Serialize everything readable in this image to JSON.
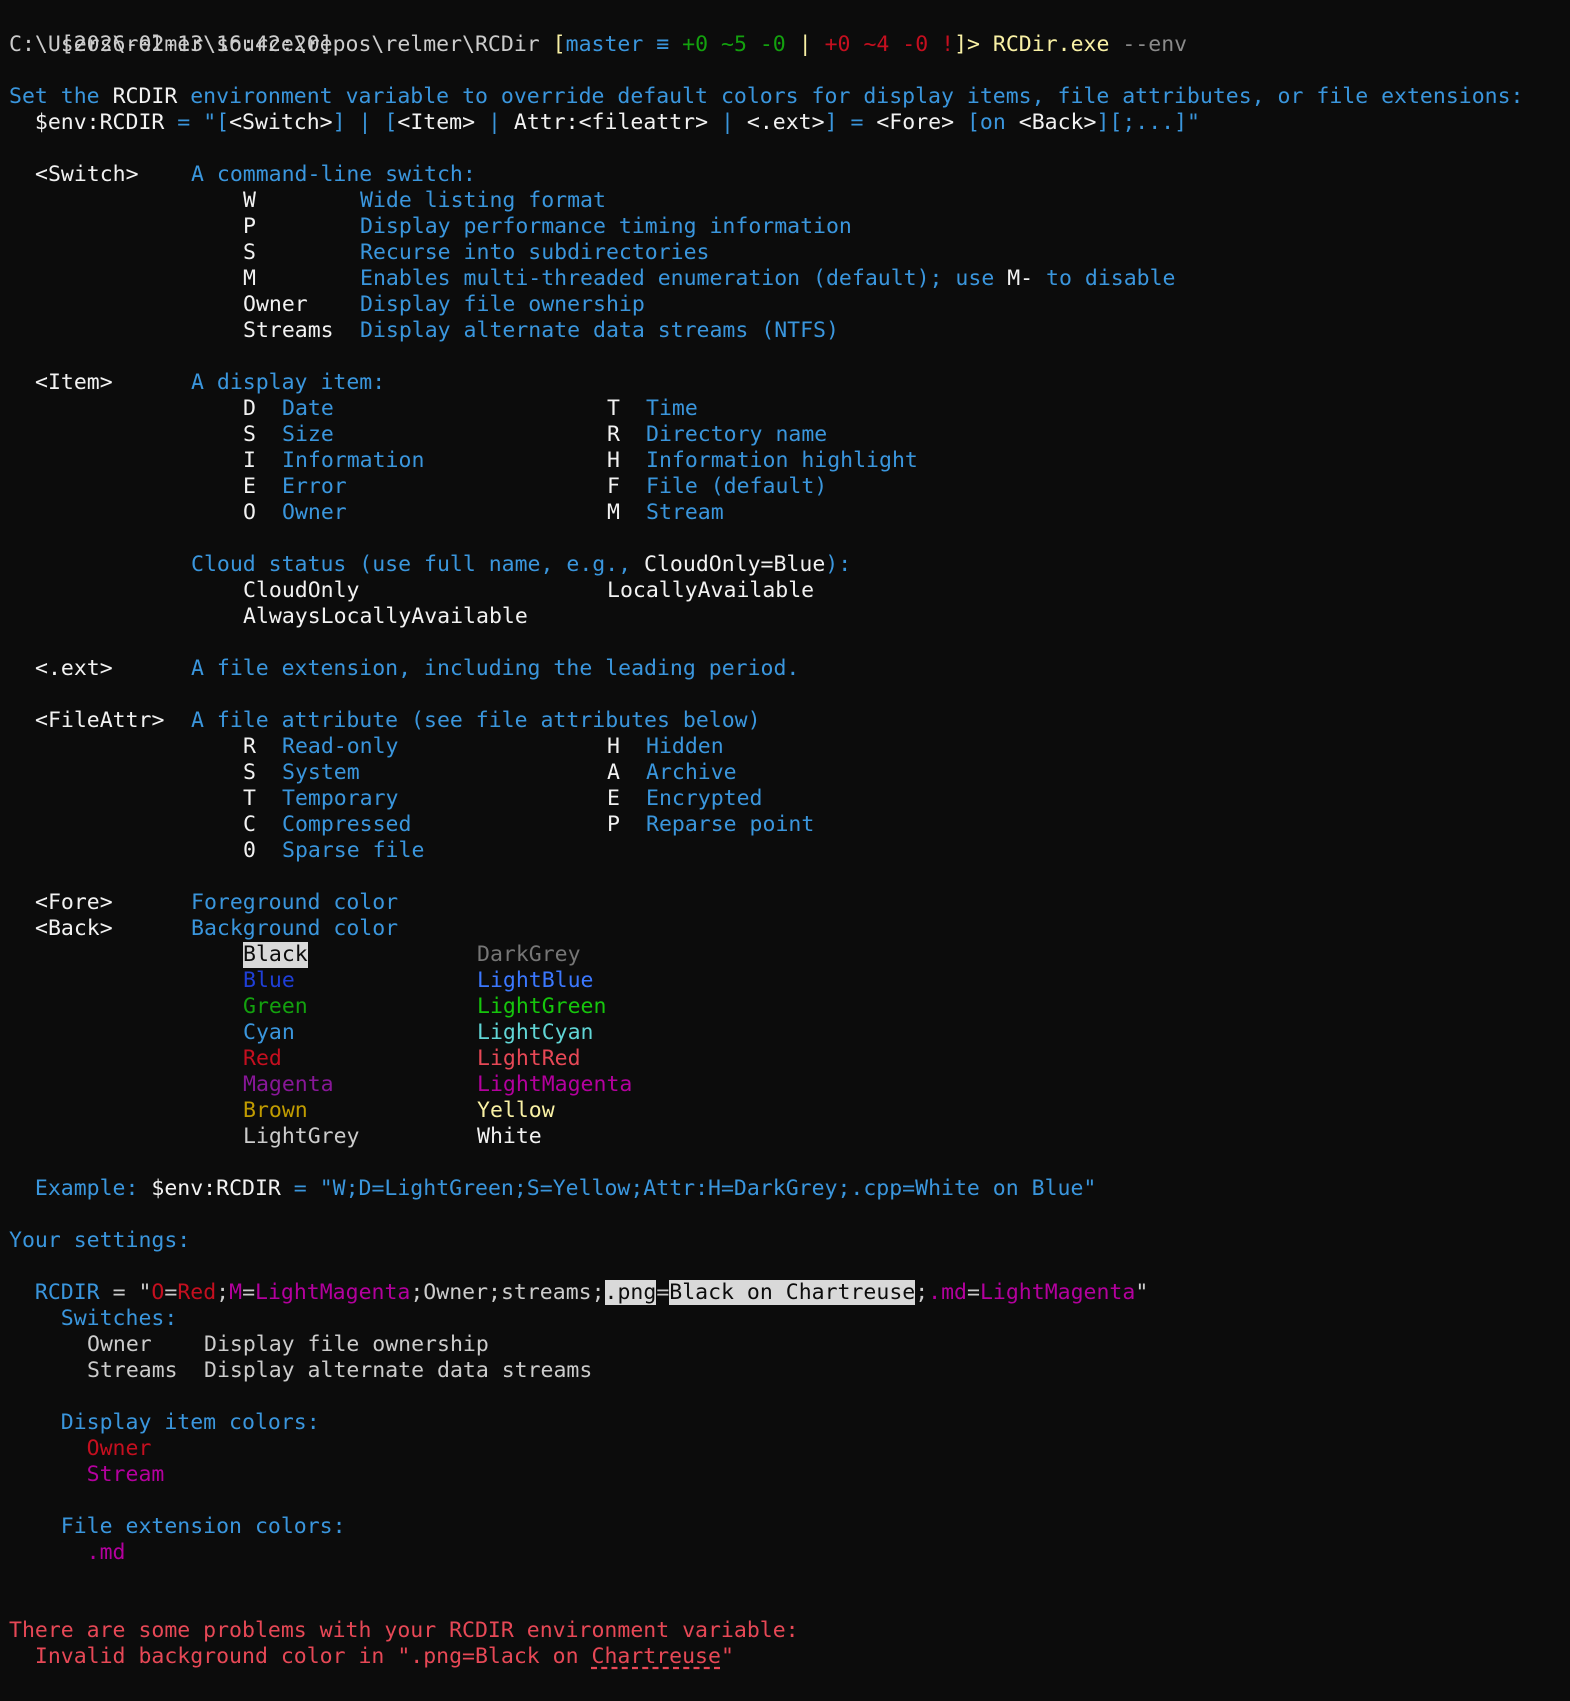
{
  "prompt": {
    "timestamp": "[2026-02-13 16:42:20]",
    "path": "C:\\Users\\relmer\\source\\repos\\relmer\\RCDir",
    "branch_open": "[",
    "branch": "master",
    "sync": "≡",
    "staged_add": "+0",
    "staged_mod": "~5",
    "staged_del": "-0",
    "sep": "|",
    "wt_add": "+0",
    "wt_mod": "~4",
    "wt_del": "-0",
    "wt_flag": "!",
    "branch_close": "]>",
    "command": "RCDir.exe",
    "arg": "--env"
  },
  "intro": {
    "set_a": "Set the ",
    "set_b": "RCDIR",
    "set_c": " environment variable to override default colors for display items, file attributes, or file extensions:",
    "syn_1": "$env:RCDIR",
    "syn_2": " = ",
    "syn_3": "\"[",
    "syn_4": "<Switch>",
    "syn_5": "] | [",
    "syn_6": "<Item>",
    "syn_7": " | ",
    "syn_8": "Attr:<fileattr>",
    "syn_9": " | ",
    "syn_10": "<.ext>",
    "syn_11": "] = ",
    "syn_12": "<Fore>",
    "syn_13": " [on ",
    "syn_14": "<Back>",
    "syn_15": "][;...]\""
  },
  "switch_section": {
    "label": "<Switch>",
    "desc": "A command-line switch:",
    "rows": [
      {
        "key": "W",
        "desc": "Wide listing format"
      },
      {
        "key": "P",
        "desc": "Display performance timing information"
      },
      {
        "key": "S",
        "desc": "Recurse into subdirectories"
      },
      {
        "key": "M",
        "desc_a": "Enables multi-threaded enumeration (default); use ",
        "desc_b": "M-",
        "desc_c": " to disable"
      },
      {
        "key": "Owner",
        "desc": "Display file ownership"
      },
      {
        "key": "Streams",
        "desc": "Display alternate data streams (NTFS)"
      }
    ]
  },
  "item_section": {
    "label": "<Item>",
    "desc": "A display item:",
    "rows": [
      {
        "k1": "D",
        "v1": "Date",
        "k2": "T",
        "v2": "Time"
      },
      {
        "k1": "S",
        "v1": "Size",
        "k2": "R",
        "v2": "Directory name"
      },
      {
        "k1": "I",
        "v1": "Information",
        "k2": "H",
        "v2": "Information highlight"
      },
      {
        "k1": "E",
        "v1": "Error",
        "k2": "F",
        "v2": "File (default)"
      },
      {
        "k1": "O",
        "v1": "Owner",
        "k2": "M",
        "v2": "Stream"
      }
    ],
    "cloud_a": "Cloud status (use full name, e.g., ",
    "cloud_b": "CloudOnly=Blue",
    "cloud_c": "):",
    "cloud_1": "CloudOnly",
    "cloud_2": "LocallyAvailable",
    "cloud_3": "AlwaysLocallyAvailable"
  },
  "ext_section": {
    "label": "<.ext>",
    "desc": "A file extension, including the leading period."
  },
  "attr_section": {
    "label": "<FileAttr>",
    "desc": "A file attribute (see file attributes below)",
    "rows": [
      {
        "k1": "R",
        "v1": "Read-only",
        "k2": "H",
        "v2": "Hidden"
      },
      {
        "k1": "S",
        "v1": "System",
        "k2": "A",
        "v2": "Archive"
      },
      {
        "k1": "T",
        "v1": "Temporary",
        "k2": "E",
        "v2": "Encrypted"
      },
      {
        "k1": "C",
        "v1": "Compressed",
        "k2": "P",
        "v2": "Reparse point"
      },
      {
        "k1": "0",
        "v1": "Sparse file",
        "k2": "",
        "v2": ""
      }
    ]
  },
  "color_section": {
    "fore_label": "<Fore>",
    "fore_desc": "Foreground color",
    "back_label": "<Back>",
    "back_desc": "Background color",
    "colors": [
      {
        "c1": "Black",
        "c1_color": "#0c0c0c",
        "c2": "DarkGrey",
        "c2_color": "#767676"
      },
      {
        "c1": "Blue",
        "c1_color": "#1f3fd8",
        "c2": "LightBlue",
        "c2_color": "#3b78ff"
      },
      {
        "c1": "Green",
        "c1_color": "#13a10e",
        "c2": "LightGreen",
        "c2_color": "#16c60c"
      },
      {
        "c1": "Cyan",
        "c1_color": "#3a96dd",
        "c2": "LightCyan",
        "c2_color": "#61d6d6"
      },
      {
        "c1": "Red",
        "c1_color": "#c50f1f",
        "c2": "LightRed",
        "c2_color": "#e74856"
      },
      {
        "c1": "Magenta",
        "c1_color": "#881798",
        "c2": "LightMagenta",
        "c2_color": "#b4009e"
      },
      {
        "c1": "Brown",
        "c1_color": "#c19c00",
        "c2": "Yellow",
        "c2_color": "#f9f1a5"
      },
      {
        "c1": "LightGrey",
        "c1_color": "#cccccc",
        "c2": "White",
        "c2_color": "#f2f2f2"
      }
    ],
    "example_label": "Example:",
    "example_var": "$env:RCDIR",
    "example_eq": " = ",
    "example_val": "\"W;D=LightGreen;S=Yellow;Attr:H=DarkGrey;.cpp=White on Blue\""
  },
  "settings": {
    "title": "Your settings:",
    "var_name": "RCDIR",
    "eq": " = \"",
    "p1": "O",
    "p2": "=",
    "p3": "Red",
    "p4": ";",
    "p5": "M",
    "p6": "=",
    "p7": "LightMagenta",
    "p8": ";Owner;streams;",
    "p9": ".png",
    "p10": "=",
    "p11": "Black on Chartreuse",
    "p12": ";",
    "p13": ".md",
    "p14": "=",
    "p15": "LightMagenta",
    "p16": "\"",
    "switches_title": "Switches:",
    "switches": [
      {
        "key": "Owner",
        "desc": "Display file ownership"
      },
      {
        "key": "Streams",
        "desc": "Display alternate data streams"
      }
    ],
    "item_colors_title": "Display item colors:",
    "item_colors": [
      "Owner",
      "Stream"
    ],
    "ext_colors_title": "File extension colors:",
    "ext_colors": [
      ".md"
    ]
  },
  "problems": {
    "title": "There are some problems with your RCDIR environment variable:",
    "msg_a": "Invalid background color in \".png=Black on ",
    "msg_b": "Chartreuse",
    "msg_c": "\""
  }
}
